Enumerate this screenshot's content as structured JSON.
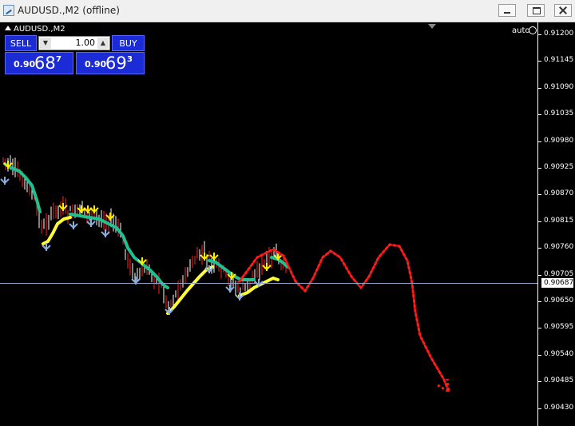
{
  "window": {
    "title": "AUDUSD.,M2 (offline)"
  },
  "chart": {
    "symbol": "AUDUSD.,M2",
    "auto_label": "auto"
  },
  "trade_panel": {
    "sell_label": "SELL",
    "buy_label": "BUY",
    "lot_value": "1.00",
    "bid": {
      "prefix": "0.90",
      "big": "68",
      "sup": "7"
    },
    "ask": {
      "prefix": "0.90",
      "big": "69",
      "sup": "3"
    }
  },
  "price_axis": {
    "labels": [
      "0.91200",
      "0.91145",
      "0.91090",
      "0.91035",
      "0.90980",
      "0.90925",
      "0.90870",
      "0.90815",
      "0.90760",
      "0.90705",
      "0.90650",
      "0.90595",
      "0.90540",
      "0.90485",
      "0.90430"
    ],
    "current_price": "0.90687"
  },
  "colors": {
    "bull_candle": "#ffffff",
    "bear_candle": "#ff2020",
    "trend_up_band": "#20c090",
    "trend_down_band": "#ffff33",
    "sell_arrow": "#ffee00",
    "buy_arrow": "#8aaee0",
    "forecast": "#ff1a1a"
  }
}
